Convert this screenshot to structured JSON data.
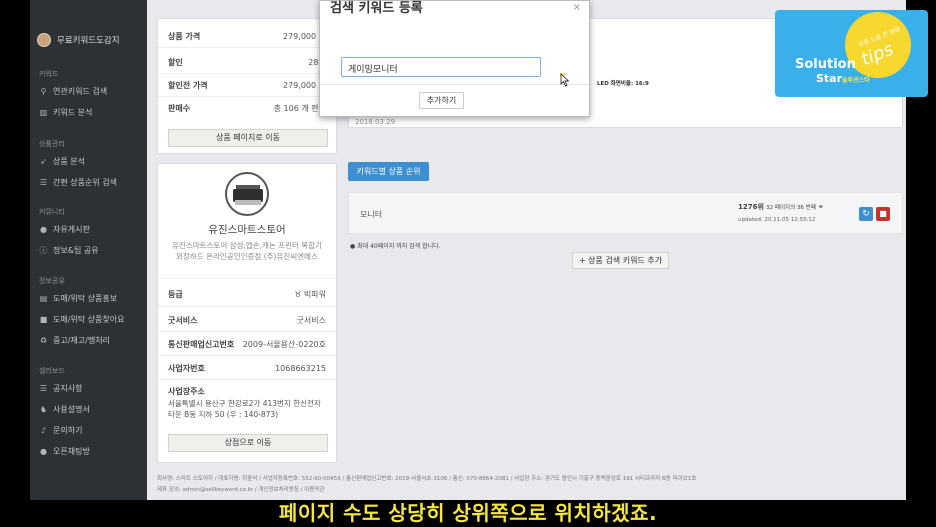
{
  "sidebar": {
    "user": "무료키워드도감지",
    "sections": [
      {
        "title": "키워드",
        "items": [
          {
            "icon": "search-icon",
            "label": "연관키워드 검색"
          },
          {
            "icon": "bar-chart-icon",
            "label": "키워드 분석"
          }
        ]
      },
      {
        "title": "상품관리",
        "items": [
          {
            "icon": "rocket-icon",
            "label": "상품 분석"
          },
          {
            "icon": "list-icon",
            "label": "간편 상품순위 검색"
          }
        ]
      },
      {
        "title": "커뮤니티",
        "items": [
          {
            "icon": "comments-icon",
            "label": "자유게시판"
          },
          {
            "icon": "info-icon",
            "label": "정보&팁 공유"
          }
        ]
      },
      {
        "title": "정보공유",
        "items": [
          {
            "icon": "store-icon",
            "label": "도매/위탁 상품홍보"
          },
          {
            "icon": "bag-icon",
            "label": "도매/위탁 상품찾아요"
          },
          {
            "icon": "recycle-icon",
            "label": "중고/재고/땡처리"
          }
        ]
      },
      {
        "title": "셀러보드",
        "items": [
          {
            "icon": "list-icon",
            "label": "공지사항"
          },
          {
            "icon": "user-secret-icon",
            "label": "사용설명서"
          },
          {
            "icon": "microphone-icon",
            "label": "문의하기"
          },
          {
            "icon": "chat-icon",
            "label": "오픈채팅방"
          }
        ]
      }
    ]
  },
  "product_card": {
    "rows": [
      {
        "key": "상품 가격",
        "value": "279,000 원"
      },
      {
        "key": "할인",
        "value": "28%"
      },
      {
        "key": "할인전 가격",
        "value": "279,000 원"
      },
      {
        "key": "판매수",
        "value": "총 106 개 판매"
      }
    ],
    "button": "상품 페이지로 이동"
  },
  "store_card": {
    "name": "유진스마트스토어",
    "description": "유진스마트스토어 삼성,엡손,캐논 프린터 복합기 외장하드 온라인공인인증점 (주)유진씨엔에스",
    "rows": [
      {
        "key": "등급",
        "value": "빅파워"
      },
      {
        "key": "굿서비스",
        "value": "굿서비스"
      },
      {
        "key": "통신판매업신고번호",
        "value": "2009-서울용산-0220호"
      },
      {
        "key": "사업자번호",
        "value": "1068663215"
      }
    ],
    "address_label": "사업장주소",
    "address": "서울특별시 용산구 한강로2가 413번지 한신전자타운 B동 지하 50 (우 : 140-873)",
    "button": "상점으로 이동"
  },
  "main": {
    "spec_text": "LED   화면비율: 16:9",
    "date": "2018.03.29",
    "rank_button": "키워드별 상품 순위",
    "keyword": "모니터",
    "rank": "1276위",
    "rank_detail": "32 페이지의 36 번째",
    "updated": "updated: 20.11.05 12:55:12",
    "note": "최대 40페이지 까지 검색 합니다.",
    "add_button": "+ 상품 검색 키워드 추가"
  },
  "footer": {
    "line1": "회사명: 스마트 스토어지 / 대표자명: 최윤석 / 사업자등록번호: 552-90-00453 / 통신판매업신고번호: 2019-서울서초-3106 / 통신: 070-8664-2081 / 사업장 주소: 경기도 용인시 기흥구 동백중앙로 191 씨티프라자 B동 파이브1호",
    "line2": "제휴 문의: admin@sellkeyword.co.kr / 개인정보처리방침 / 이용약관"
  },
  "modal": {
    "title": "검색 키워드 등록",
    "close": "×",
    "input_value": "게이밍모니터",
    "submit": "추가하기"
  },
  "logo": {
    "line1": "Solution",
    "line2": "Star",
    "line2_small": "솔루션스타",
    "tips_small": "작은 도움 큰 변화",
    "tips": "tips"
  },
  "subtitle": "페이지 수도 상당히 상위쪽으로 위치하겠죠."
}
